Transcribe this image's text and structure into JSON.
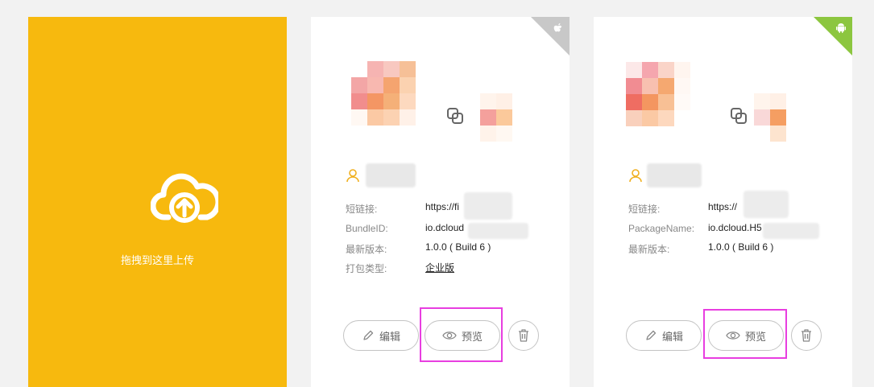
{
  "upload": {
    "label": "拖拽到这里上传",
    "icon": "cloud-upload-icon"
  },
  "colors": {
    "accent": "#f7b90e",
    "ios_corner": "#c8c8c8",
    "android_corner": "#8cc63f",
    "highlight": "#e83ee0"
  },
  "cards": [
    {
      "platform": "ios",
      "platform_icon": "apple-icon",
      "fields": [
        {
          "label": "短链接:",
          "value": "https://fi"
        },
        {
          "label": "BundleID:",
          "value": "io.dcloud"
        },
        {
          "label": "最新版本:",
          "value": "1.0.0 ( Build 6 )"
        },
        {
          "label": "打包类型:",
          "value": "企业版"
        }
      ],
      "buttons": {
        "edit": "编辑",
        "preview": "预览"
      }
    },
    {
      "platform": "android",
      "platform_icon": "android-icon",
      "fields": [
        {
          "label": "短链接:",
          "value": "https://"
        },
        {
          "label": "PackageName:",
          "value": "io.dcloud.H5"
        },
        {
          "label": "最新版本:",
          "value": "1.0.0 ( Build 6 )"
        }
      ],
      "buttons": {
        "edit": "编辑",
        "preview": "预览"
      }
    }
  ]
}
